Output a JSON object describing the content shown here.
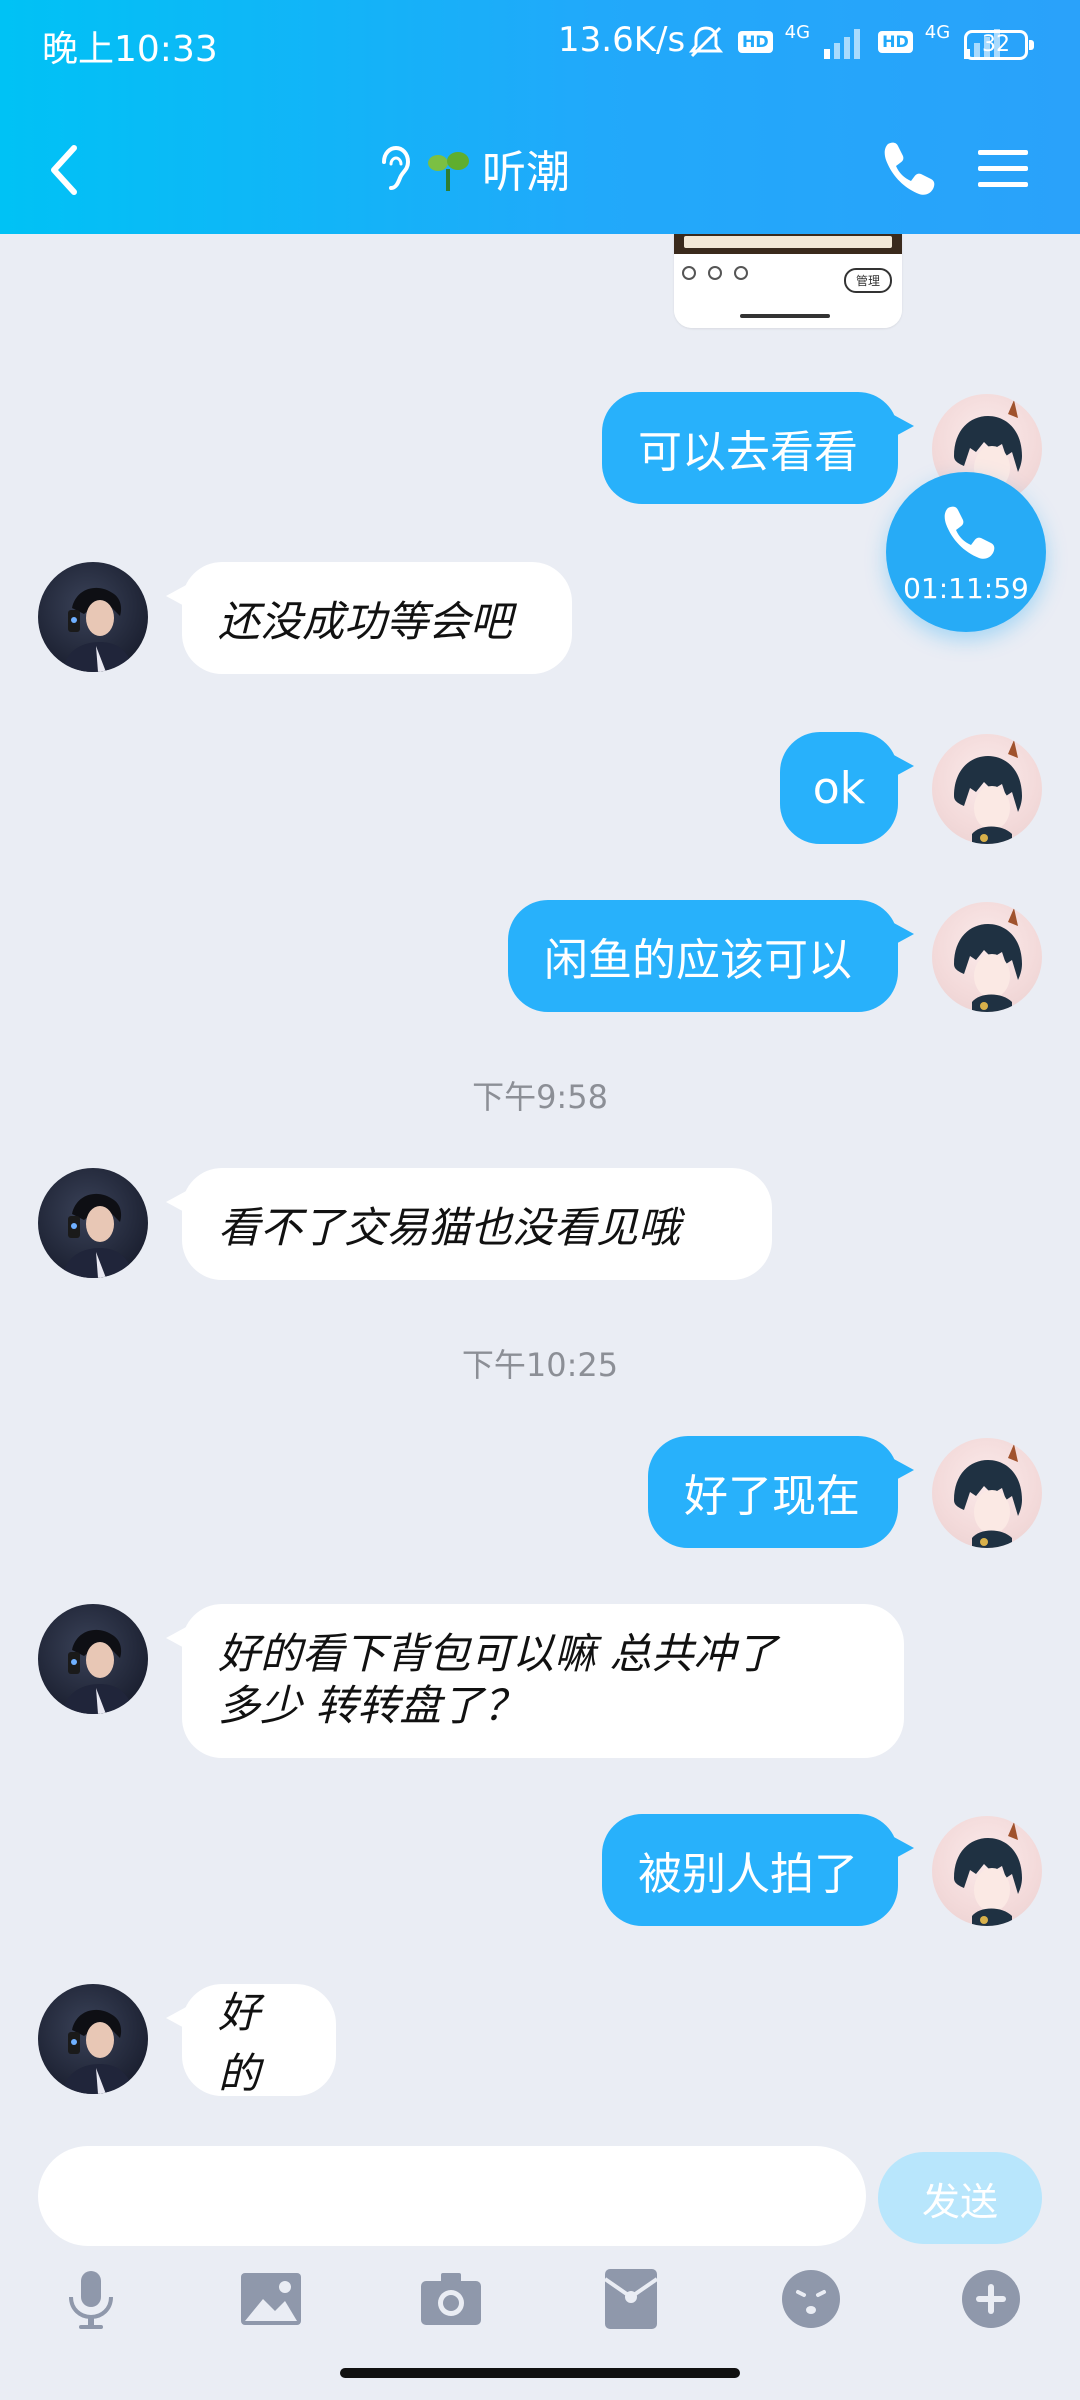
{
  "status_bar": {
    "time": "晚上10:33",
    "network_speed": "13.6K/s",
    "hd1": "HD",
    "hd2": "HD",
    "sig1": "4G",
    "sig2": "4G",
    "battery": "32"
  },
  "header": {
    "title": "听潮",
    "icons": [
      "back-arrow-icon",
      "ear-icon",
      "sprout-icon",
      "phone-icon",
      "menu-icon"
    ]
  },
  "shared_image": {
    "manage_label": "管理"
  },
  "messages": [
    {
      "from": "me",
      "text": "可以去看看"
    },
    {
      "from": "them",
      "text": "还没成功等会吧"
    },
    {
      "from": "me",
      "text": "ok"
    },
    {
      "from": "me",
      "text": "闲鱼的应该可以"
    },
    {
      "type": "time",
      "text": "下午9:58"
    },
    {
      "from": "them",
      "text": "看不了交易猫也没看见哦"
    },
    {
      "type": "time",
      "text": "下午10:25"
    },
    {
      "from": "me",
      "text": "好了现在"
    },
    {
      "from": "them",
      "text_line1": "好的看下背包可以嘛 总共冲了",
      "text_line2": "多少 转转盘了？"
    },
    {
      "from": "me",
      "text": "被别人拍了"
    },
    {
      "from": "them",
      "text": "好的"
    }
  ],
  "call_float": {
    "duration": "01:11:59"
  },
  "composer": {
    "placeholder": "",
    "send_label": "发送",
    "tools": [
      "microphone-icon",
      "image-icon",
      "camera-icon",
      "red-packet-icon",
      "emoji-icon",
      "plus-icon"
    ]
  },
  "colors": {
    "accent": "#28B1FB",
    "background": "#EAEDF4"
  }
}
